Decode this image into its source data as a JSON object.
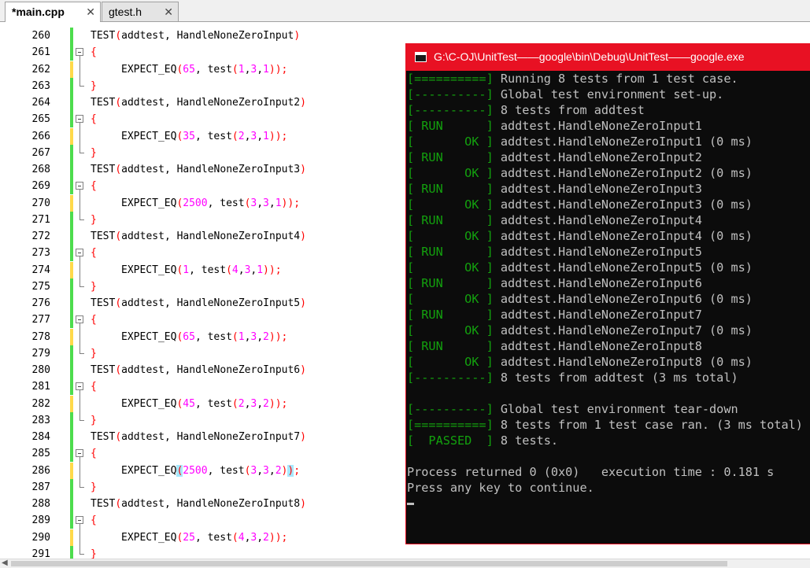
{
  "tabs": [
    {
      "label": "*main.cpp",
      "active": true
    },
    {
      "label": "gtest.h",
      "active": false
    }
  ],
  "tab_close_glyph": "✕",
  "editor": {
    "lines": [
      {
        "n": "260",
        "type": "test",
        "name": "HandleNoneZeroInput"
      },
      {
        "n": "261",
        "type": "open",
        "text": "{"
      },
      {
        "n": "262",
        "type": "expect",
        "expected": "65",
        "args": "1,3,1"
      },
      {
        "n": "263",
        "type": "close",
        "text": "}"
      },
      {
        "n": "264",
        "type": "test",
        "name": "HandleNoneZeroInput2"
      },
      {
        "n": "265",
        "type": "open",
        "text": "{"
      },
      {
        "n": "266",
        "type": "expect",
        "expected": "35",
        "args": "2,3,1"
      },
      {
        "n": "267",
        "type": "close",
        "text": "}"
      },
      {
        "n": "268",
        "type": "test",
        "name": "HandleNoneZeroInput3"
      },
      {
        "n": "269",
        "type": "open",
        "text": "{"
      },
      {
        "n": "270",
        "type": "expect",
        "expected": "2500",
        "args": "3,3,1"
      },
      {
        "n": "271",
        "type": "close",
        "text": "}"
      },
      {
        "n": "272",
        "type": "test",
        "name": "HandleNoneZeroInput4"
      },
      {
        "n": "273",
        "type": "open",
        "text": "{"
      },
      {
        "n": "274",
        "type": "expect",
        "expected": "1",
        "args": "4,3,1"
      },
      {
        "n": "275",
        "type": "close",
        "text": "}"
      },
      {
        "n": "276",
        "type": "test",
        "name": "HandleNoneZeroInput5"
      },
      {
        "n": "277",
        "type": "open",
        "text": "{"
      },
      {
        "n": "278",
        "type": "expect",
        "expected": "65",
        "args": "1,3,2"
      },
      {
        "n": "279",
        "type": "close",
        "text": "}"
      },
      {
        "n": "280",
        "type": "test",
        "name": "HandleNoneZeroInput6"
      },
      {
        "n": "281",
        "type": "open",
        "text": "{"
      },
      {
        "n": "282",
        "type": "expect",
        "expected": "45",
        "args": "2,3,2"
      },
      {
        "n": "283",
        "type": "close",
        "text": "}"
      },
      {
        "n": "284",
        "type": "test",
        "name": "HandleNoneZeroInput7"
      },
      {
        "n": "285",
        "type": "open",
        "text": "{"
      },
      {
        "n": "286",
        "type": "expect",
        "expected": "2500",
        "args": "3,3,2",
        "highlight_parens": true
      },
      {
        "n": "287",
        "type": "close",
        "text": "}"
      },
      {
        "n": "288",
        "type": "test",
        "name": "HandleNoneZeroInput8"
      },
      {
        "n": "289",
        "type": "open",
        "text": "{"
      },
      {
        "n": "290",
        "type": "expect",
        "expected": "25",
        "args": "4,3,2"
      },
      {
        "n": "291",
        "type": "close",
        "text": "}"
      }
    ],
    "test_macro": "TEST",
    "suite": "addtest",
    "expect_macro": "EXPECT_EQ",
    "func": "test",
    "colors": {
      "changed_saved": "#4ddc4d",
      "changed_unsaved": "#ffd94a",
      "brace": "#ff0000",
      "number": "#ff00ff",
      "paren_match": "#a6e8ff"
    }
  },
  "console": {
    "title": "G:\\C-OJ\\UnitTest——google\\bin\\Debug\\UnitTest——google.exe",
    "lines": [
      {
        "tag": "[==========]",
        "text": " Running 8 tests from 1 test case."
      },
      {
        "tag": "[----------]",
        "text": " Global test environment set-up."
      },
      {
        "tag": "[----------]",
        "text": " 8 tests from addtest"
      },
      {
        "tag": "[ RUN      ]",
        "text": " addtest.HandleNoneZeroInput1"
      },
      {
        "tag": "[       OK ]",
        "text": " addtest.HandleNoneZeroInput1 (0 ms)"
      },
      {
        "tag": "[ RUN      ]",
        "text": " addtest.HandleNoneZeroInput2"
      },
      {
        "tag": "[       OK ]",
        "text": " addtest.HandleNoneZeroInput2 (0 ms)"
      },
      {
        "tag": "[ RUN      ]",
        "text": " addtest.HandleNoneZeroInput3"
      },
      {
        "tag": "[       OK ]",
        "text": " addtest.HandleNoneZeroInput3 (0 ms)"
      },
      {
        "tag": "[ RUN      ]",
        "text": " addtest.HandleNoneZeroInput4"
      },
      {
        "tag": "[       OK ]",
        "text": " addtest.HandleNoneZeroInput4 (0 ms)"
      },
      {
        "tag": "[ RUN      ]",
        "text": " addtest.HandleNoneZeroInput5"
      },
      {
        "tag": "[       OK ]",
        "text": " addtest.HandleNoneZeroInput5 (0 ms)"
      },
      {
        "tag": "[ RUN      ]",
        "text": " addtest.HandleNoneZeroInput6"
      },
      {
        "tag": "[       OK ]",
        "text": " addtest.HandleNoneZeroInput6 (0 ms)"
      },
      {
        "tag": "[ RUN      ]",
        "text": " addtest.HandleNoneZeroInput7"
      },
      {
        "tag": "[       OK ]",
        "text": " addtest.HandleNoneZeroInput7 (0 ms)"
      },
      {
        "tag": "[ RUN      ]",
        "text": " addtest.HandleNoneZeroInput8"
      },
      {
        "tag": "[       OK ]",
        "text": " addtest.HandleNoneZeroInput8 (0 ms)"
      },
      {
        "tag": "[----------]",
        "text": " 8 tests from addtest (3 ms total)"
      },
      {
        "tag": "",
        "text": ""
      },
      {
        "tag": "[----------]",
        "text": " Global test environment tear-down"
      },
      {
        "tag": "[==========]",
        "text": " 8 tests from 1 test case ran. (3 ms total)"
      },
      {
        "tag": "[  PASSED  ]",
        "text": " 8 tests."
      },
      {
        "tag": "",
        "text": ""
      },
      {
        "tag": "",
        "text": "Process returned 0 (0x0)   execution time : 0.181 s"
      },
      {
        "tag": "",
        "text": "Press any key to continue."
      }
    ],
    "colors": {
      "background": "#0c0c0c",
      "text": "#c0c0c0",
      "tag": "#13a10e",
      "title_bar": "#e81123"
    }
  }
}
